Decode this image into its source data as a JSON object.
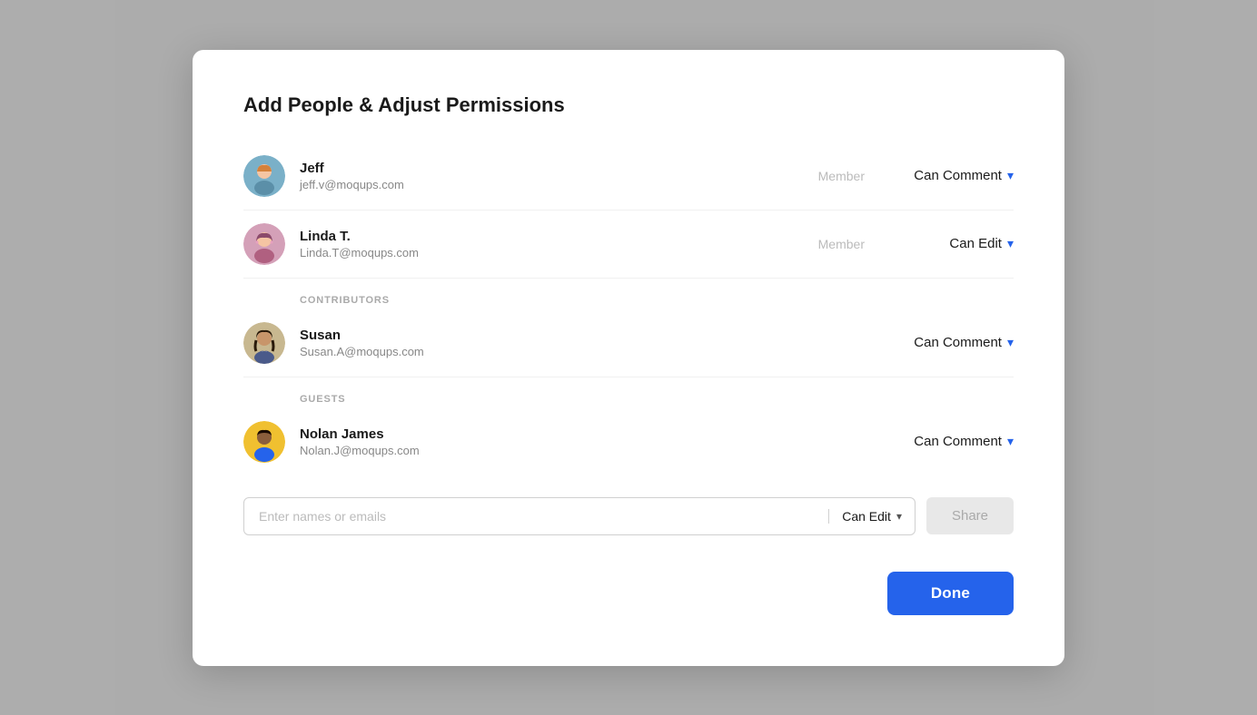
{
  "modal": {
    "title": "Add People & Adjust Permissions"
  },
  "members": [
    {
      "id": "jeff",
      "name": "Jeff",
      "email": "jeff.v@moqups.com",
      "role": "Member",
      "permission": "Can Comment",
      "avatar_color": "#b0c4de",
      "avatar_type": "jeff"
    },
    {
      "id": "linda",
      "name": "Linda T.",
      "email": "Linda.T@moqups.com",
      "role": "Member",
      "permission": "Can Edit",
      "avatar_color": "#c8a0b0",
      "avatar_type": "linda"
    }
  ],
  "contributors": {
    "label": "CONTRIBUTORS",
    "items": [
      {
        "id": "susan",
        "name": "Susan",
        "email": "Susan.A@moqups.com",
        "role": "",
        "permission": "Can Comment",
        "avatar_type": "susan"
      }
    ]
  },
  "guests": {
    "label": "GUESTS",
    "items": [
      {
        "id": "nolan",
        "name": "Nolan James",
        "email": "Nolan.J@moqups.com",
        "role": "",
        "permission": "Can Comment",
        "avatar_type": "nolan"
      }
    ]
  },
  "invite": {
    "placeholder": "Enter names or emails",
    "permission": "Can Edit",
    "share_label": "Share"
  },
  "done_button": "Done",
  "chevron": "⌄",
  "icons": {
    "chevron_down": "▾"
  }
}
